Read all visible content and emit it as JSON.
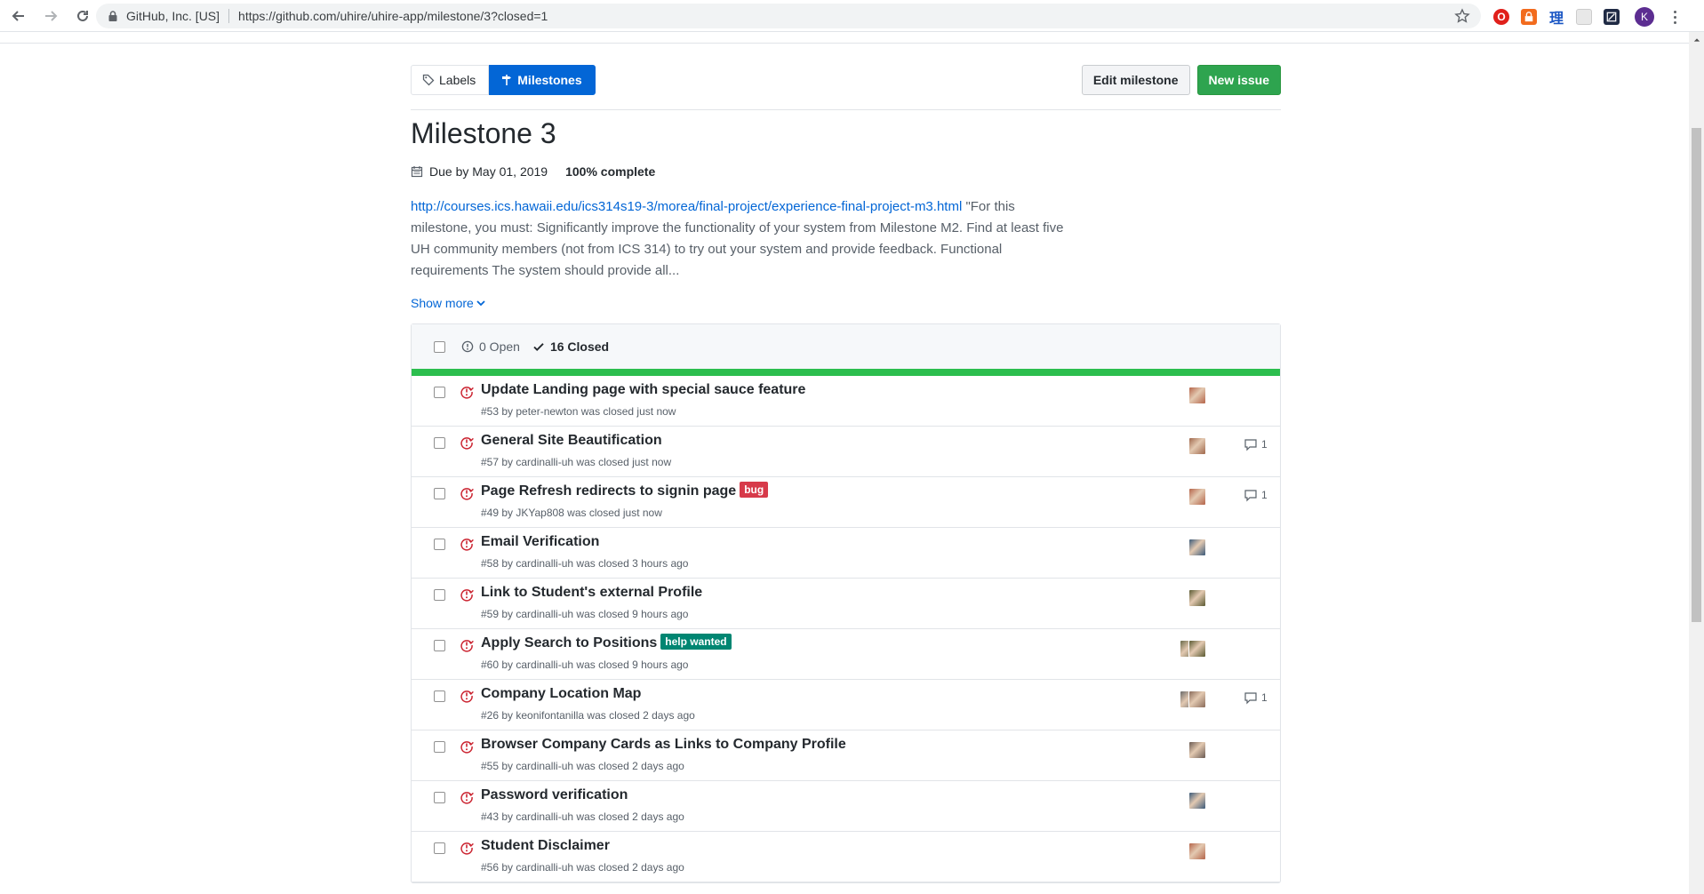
{
  "browser": {
    "site_identity": "GitHub, Inc. [US]",
    "url": "https://github.com/uhire/uhire-app/milestone/3?closed=1",
    "profile_initial": "K",
    "extension_glyph": "理"
  },
  "subnav": {
    "labels": "Labels",
    "milestones": "Milestones"
  },
  "actions": {
    "edit": "Edit milestone",
    "new_issue": "New issue"
  },
  "milestone": {
    "title": "Milestone 3",
    "due": "Due by May 01, 2019",
    "progress_text": "100% complete",
    "progress_fraction": 1.0,
    "description_link": "http://courses.ics.hawaii.edu/ics314s19-3/morea/final-project/experience-final-project-m3.html",
    "description_text": " \"For this milestone, you must: Significantly improve the functionality of your system from Milestone M2. Find at least five UH community members (not from ICS 314) to try out your system and provide feedback. Functional requirements The system should provide all...",
    "show_more": "Show more"
  },
  "states": {
    "open": "0 Open",
    "closed": "16 Closed"
  },
  "colors": {
    "accent_blue": "#0366d6",
    "green": "#2ea44f",
    "closed_red": "#cb2431",
    "bug_label": "#d73a4a",
    "help_wanted_label": "#008672"
  },
  "issues": [
    {
      "title": "Update Landing page with special sauce feature",
      "sub": "#53 by peter-newton was closed just now",
      "comments": "",
      "label": null,
      "avatars": [
        "#b5654a"
      ]
    },
    {
      "title": "General Site Beautification",
      "sub": "#57 by cardinalli-uh was closed just now",
      "comments": "1",
      "label": null,
      "avatars": [
        "#a0684c"
      ]
    },
    {
      "title": "Page Refresh redirects to signin page",
      "sub": "#49 by JKYap808 was closed just now",
      "comments": "1",
      "label": {
        "text": "bug",
        "color": "#d73a4a"
      },
      "avatars": [
        "#b5654a"
      ]
    },
    {
      "title": "Email Verification",
      "sub": "#58 by cardinalli-uh was closed 3 hours ago",
      "comments": "",
      "label": null,
      "avatars": [
        "#3b5a7a"
      ]
    },
    {
      "title": "Link to Student's external Profile",
      "sub": "#59 by cardinalli-uh was closed 9 hours ago",
      "comments": "",
      "label": null,
      "avatars": [
        "#5a5a32"
      ]
    },
    {
      "title": "Apply Search to Positions",
      "sub": "#60 by cardinalli-uh was closed 9 hours ago",
      "comments": "",
      "label": {
        "text": "help wanted",
        "color": "#008672"
      },
      "avatars": [
        "#6a6a4a",
        "#5a5a32"
      ]
    },
    {
      "title": "Company Location Map",
      "sub": "#26 by keonifontanilla was closed 2 days ago",
      "comments": "1",
      "label": null,
      "avatars": [
        "#6a6a6a",
        "#8a6b5a"
      ]
    },
    {
      "title": "Browser Company Cards as Links to Company Profile",
      "sub": "#55 by cardinalli-uh was closed 2 days ago",
      "comments": "",
      "label": null,
      "avatars": [
        "#6a5a52"
      ]
    },
    {
      "title": "Password verification",
      "sub": "#43 by cardinalli-uh was closed 2 days ago",
      "comments": "",
      "label": null,
      "avatars": [
        "#3b5a7a"
      ]
    },
    {
      "title": "Student Disclaimer",
      "sub": "#56 by cardinalli-uh was closed 2 days ago",
      "comments": "",
      "label": null,
      "avatars": [
        "#b5654a"
      ]
    }
  ]
}
